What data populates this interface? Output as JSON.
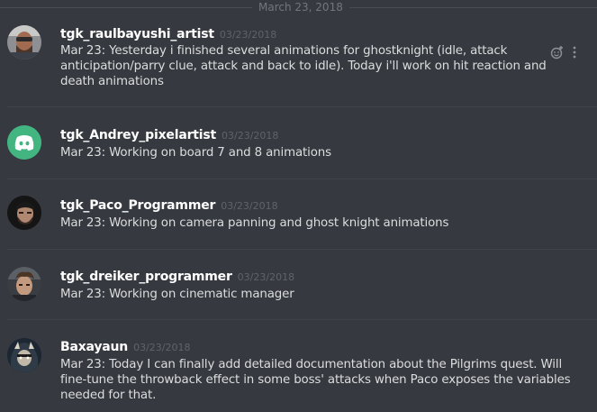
{
  "date_divider": "March 23, 2018",
  "messages": [
    {
      "username": "tgk_raulbayushi_artist",
      "timestamp": "03/23/2018",
      "text": "Mar 23: Yesterday i finished several animations for ghostknight (idle, attack anticipation/parry clue, attack and back to idle). Today i'll work on hit reaction and death animations"
    },
    {
      "username": "tgk_Andrey_pixelartist",
      "timestamp": "03/23/2018",
      "text": "Mar 23: Working on board 7 and 8 animations"
    },
    {
      "username": "tgk_Paco_Programmer",
      "timestamp": "03/23/2018",
      "text": "Mar 23: Working on camera panning and ghost knight animations"
    },
    {
      "username": "tgk_dreiker_programmer",
      "timestamp": "03/23/2018",
      "text": "Mar 23: Working on cinematic manager"
    },
    {
      "username": "Baxayaun",
      "timestamp": "03/23/2018",
      "text": "Mar 23:  Today I can finally add detailed documentation about the Pilgrims quest. Will fine-tune the throwback effect in some boss' attacks when Paco exposes the variables needed for that."
    }
  ],
  "icons": {
    "add_reaction": "add-reaction-icon",
    "more": "more-options-icon",
    "discord_logo": "discord-logo-icon"
  },
  "colors": {
    "background": "#36393f",
    "username": "#ffffff",
    "message_text": "#dcddde",
    "timestamp": "#5f636a",
    "discord_blurple": "#43b581"
  }
}
